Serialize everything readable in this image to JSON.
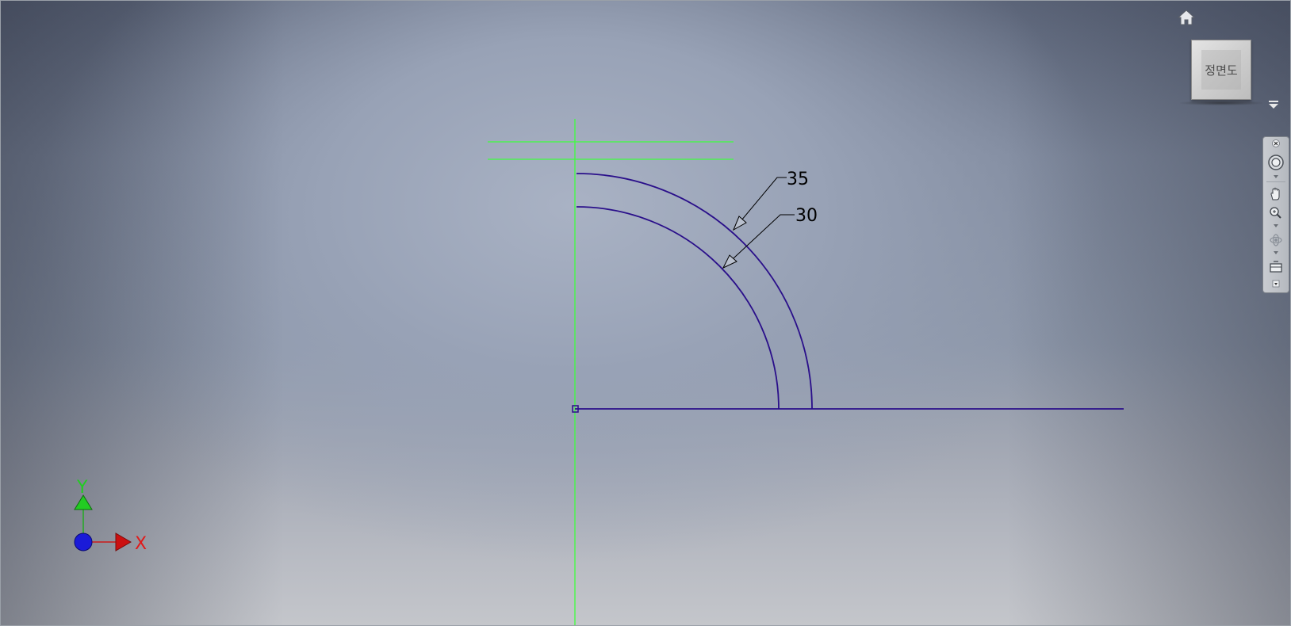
{
  "viewport": {
    "background": "gradient-gray-blue",
    "sketch_color": "#2a0f8a",
    "construction_color": "#3dff3d"
  },
  "dimensions": {
    "outer_radius_label": "35",
    "inner_radius_label": "30"
  },
  "triad": {
    "x_label": "X",
    "y_label": "Y",
    "x_color": "#e01a1a",
    "y_color": "#22cc22",
    "origin_color": "#1a1aff"
  },
  "viewcube": {
    "face_label": "정면도",
    "home_icon": "home-icon",
    "menu_icon": "triangle-down-icon"
  },
  "navbar": {
    "items": [
      {
        "icon": "close-icon"
      },
      {
        "icon": "steering-wheel-icon"
      },
      {
        "icon": "pan-hand-icon"
      },
      {
        "icon": "zoom-icon"
      },
      {
        "icon": "orbit-icon"
      },
      {
        "icon": "look-at-icon"
      },
      {
        "icon": "customize-icon"
      }
    ]
  }
}
